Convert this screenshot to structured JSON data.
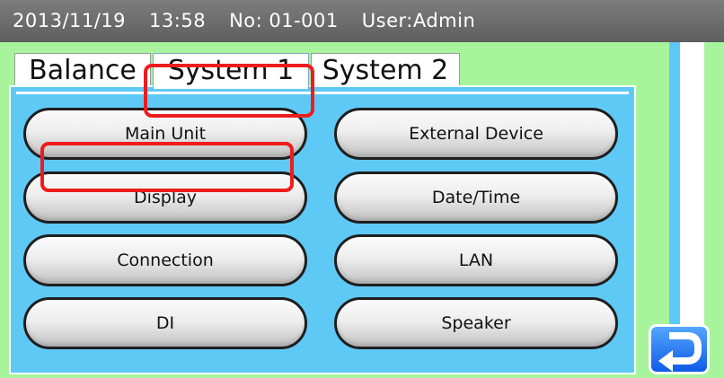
{
  "status_bar": {
    "date": "2013/11/19",
    "time": "13:58",
    "number": "No: 01-001",
    "user": "User:Admin"
  },
  "tabs": [
    {
      "label": "Balance",
      "selected": false
    },
    {
      "label": "System 1",
      "selected": true
    },
    {
      "label": "System 2",
      "selected": false
    }
  ],
  "buttons": {
    "main_unit": "Main Unit",
    "external_device": "External Device",
    "display": "Display",
    "date_time": "Date/Time",
    "connection": "Connection",
    "lan": "LAN",
    "di": "DI",
    "speaker": "Speaker"
  },
  "icons": {
    "return": "return-arrow-icon"
  },
  "colors": {
    "background": "#a7f49d",
    "panel": "#5fc9f6",
    "status_bar": "#6b6b6b",
    "highlight": "#ee1d1d",
    "return_button": "#1f6ff0"
  }
}
